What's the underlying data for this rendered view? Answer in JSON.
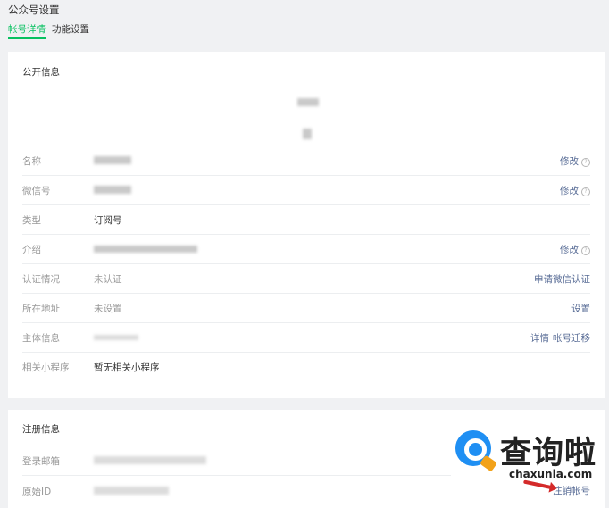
{
  "header": {
    "title": "公众号设置"
  },
  "tabs": [
    {
      "label": "帐号详情",
      "active": true
    },
    {
      "label": "功能设置",
      "active": false
    }
  ],
  "public_info": {
    "title": "公开信息",
    "rows": [
      {
        "label": "名称",
        "value": "",
        "action": "修改",
        "help": "?"
      },
      {
        "label": "微信号",
        "value": "",
        "action": "修改",
        "help": "?"
      },
      {
        "label": "类型",
        "value": "订阅号",
        "action": ""
      },
      {
        "label": "介绍",
        "value": "",
        "action": "修改",
        "help": "?"
      },
      {
        "label": "认证情况",
        "value": "未认证",
        "action": "申请微信认证"
      },
      {
        "label": "所在地址",
        "value": "未设置",
        "action": "设置"
      },
      {
        "label": "主体信息",
        "value": "",
        "action": "详情",
        "action2": "帐号迁移"
      },
      {
        "label": "相关小程序",
        "value": "暂无相关小程序",
        "action": ""
      }
    ]
  },
  "register_info": {
    "title": "注册信息",
    "rows": [
      {
        "label": "登录邮箱",
        "value": ""
      },
      {
        "label": "原始ID",
        "value": "",
        "action": "注销帐号"
      }
    ]
  },
  "watermark": {
    "text": "查询啦",
    "url": "chaxunla.com"
  },
  "colors": {
    "accent": "#07c160",
    "link": "#576b95",
    "background": "#f0f1f3"
  }
}
